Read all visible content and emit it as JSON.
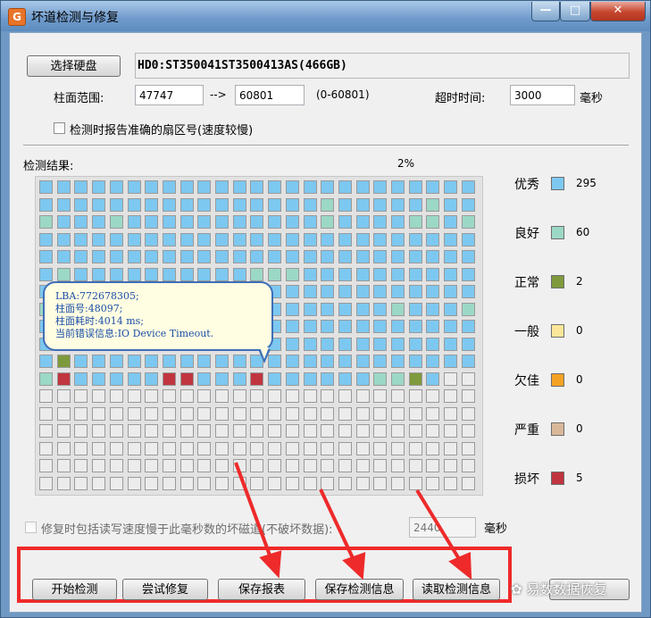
{
  "window": {
    "title": "坏道检测与修复",
    "app_icon_glyph": "G",
    "min_glyph": "—",
    "max_glyph": "□",
    "close_glyph": "✕"
  },
  "disk": {
    "select_button": "选择硬盘",
    "info": "HD0:ST350041ST3500413AS(466GB)"
  },
  "cylinder": {
    "label": "柱面范围:",
    "from": "47747",
    "arrow": "-->",
    "to": "60801",
    "range": "(0-60801)"
  },
  "timeout": {
    "label": "超时时间:",
    "value": "3000",
    "unit": "毫秒"
  },
  "report_sector": {
    "label": "检测时报告准确的扇区号(速度较慢)",
    "checked": false
  },
  "results": {
    "label": "检测结果:",
    "progress": "2%"
  },
  "legend": [
    {
      "label": "优秀",
      "color": "#7dc8f0",
      "count": "295"
    },
    {
      "label": "良好",
      "color": "#9cd8c6",
      "count": "60"
    },
    {
      "label": "正常",
      "color": "#7f9a3c",
      "count": "2"
    },
    {
      "label": "一般",
      "color": "#fbe79a",
      "count": "0"
    },
    {
      "label": "欠佳",
      "color": "#f4a224",
      "count": "0"
    },
    {
      "label": "严重",
      "color": "#d9b89a",
      "count": "0"
    },
    {
      "label": "损坏",
      "color": "#c0353f",
      "count": "5"
    }
  ],
  "grid": {
    "columns": 25,
    "rows": 18,
    "empty_color": "#ececec",
    "rows_data": [
      "EEEEEEEEEEEEEEEEEEEEEEEEE",
      "EEEEEEEEEEEEEEEEGEEEEEGEE",
      "GEEEGEEEEEEEEEEEGEEEEGGEG",
      "EEEEEEEEEEEEEEEEEEEEEEEEE",
      "EEEEEEEEEEEEEEEEEEEEEEEEE",
      "EGEEEEEEEEEEGGGEEEEEEEEEE",
      "EEEEEEEEEEEEGEEEEEEEEEEEE",
      "GEEEEGEEEEEEEEEEEEEEGEEEG",
      "EEEEEEEEEEEEEEEEEEEEEEEEE",
      "EEEEEEEEEEEEEEEEEEEEEEEEE",
      "ENEEEEEEEEEEEEEEEEEEEEEEE",
      "GBEEEEEBBEEEBEEEEEEGGNEJJ",
      "...",
      "...",
      "...",
      "...",
      "...",
      "..."
    ]
  },
  "tooltip": {
    "lba": "LBA:772678305;",
    "cylinder": "柱面号:48097;",
    "time": "柱面耗时:4014 ms;",
    "error": "当前错误信息:IO Device Timeout."
  },
  "repair_slow": {
    "label": "修复时包括读写速度慢于此毫秒数的坏磁道(不破坏数据):",
    "value": "2440",
    "unit": "毫秒",
    "checked": false
  },
  "buttons": {
    "start": "开始检测",
    "try_repair": "尝试修复",
    "save_report": "保存报表",
    "save_info": "保存检测信息",
    "read_info": "读取检测信息"
  },
  "watermark": "易数数据恢复",
  "highlight_color": "#ee2a2a"
}
